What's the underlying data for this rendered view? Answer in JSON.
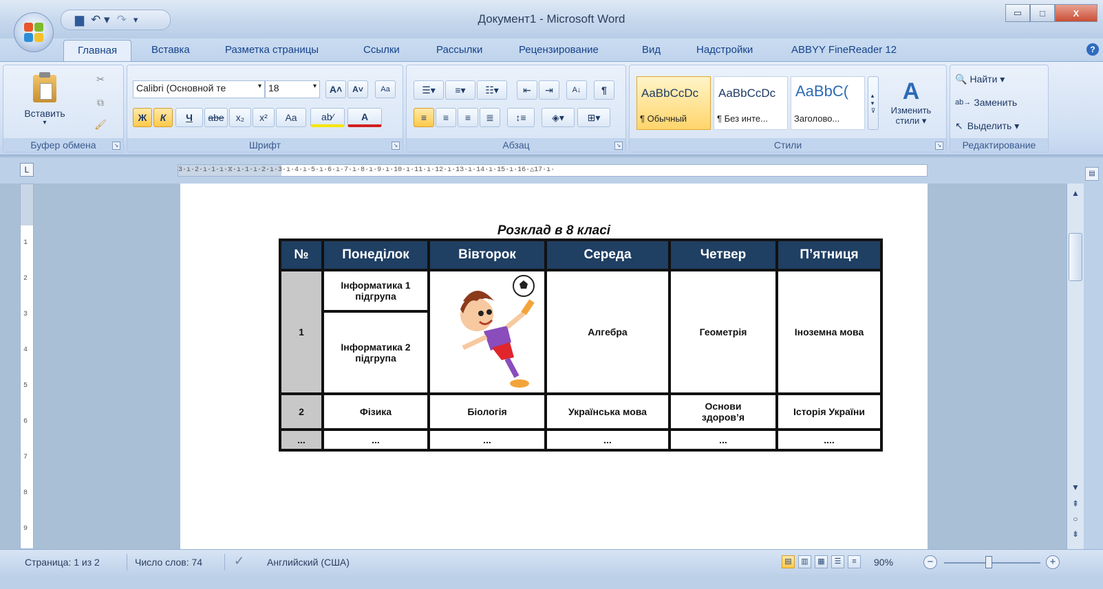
{
  "window": {
    "title": "Документ1 - Microsoft Word",
    "minimize": "–",
    "maximize": "□",
    "close": "X"
  },
  "qat": {
    "save": "💾",
    "undo": "↶ ▾",
    "redo": "↷",
    "more": "₹"
  },
  "tabs": [
    "Главная",
    "Вставка",
    "Разметка страницы",
    "Ссылки",
    "Рассылки",
    "Рецензирование",
    "Вид",
    "Надстройки",
    "ABBYY FineReader 12"
  ],
  "ribbon": {
    "clipboard": {
      "label": "Буфер обмена",
      "paste": "Вставить",
      "paste_arrow": "▾"
    },
    "font": {
      "label": "Шрифт",
      "font_name": "Calibri (Основной те",
      "font_size": "18",
      "grow": "A˄",
      "shrink": "A˅",
      "clear": "Aa",
      "bold": "Ж",
      "italic": "К",
      "underline": "Ч",
      "strike": "abe",
      "subscript": "x₂",
      "superscript": "x²",
      "case": "Aa",
      "highlight": "ab⁄",
      "color": "A"
    },
    "paragraph": {
      "label": "Абзац"
    },
    "styles": {
      "label": "Стили",
      "items": [
        {
          "sample": "AaBbCcDc",
          "name": "¶ Обычный"
        },
        {
          "sample": "AaBbCcDc",
          "name": "¶ Без инте..."
        },
        {
          "sample": "AaBbC(",
          "name": "Заголово..."
        }
      ],
      "change": "Изменить стили ▾"
    },
    "editing": {
      "label": "Редактирование",
      "find": "Найти ▾",
      "replace": "Заменить",
      "select": "Выделить ▾"
    }
  },
  "ruler": {
    "corner": "L",
    "marks": "3·ı·2·ı·1·ı·⧖·ı·1·ı·2·ı·3·ı·4·ı·5·ı·6·ı·7·ı·8·ı·9·ı·10·ı·11·ı·12·ı·13·ı·14·ı·15·ı·16·△17·ı·",
    "vmarks": [
      "1",
      "2",
      "3",
      "4",
      "5",
      "6",
      "7",
      "8",
      "9"
    ]
  },
  "document": {
    "title": "Розклад в 8 класі",
    "headers": [
      "№",
      "Понеділок",
      "Вівторок",
      "Середа",
      "Четвер",
      "П’ятниця"
    ],
    "row1": {
      "num": "1",
      "mon_a": "Інформатика 1 підгрупа",
      "mon_b": "Інформатика 2 підгрупа",
      "wed": "Алгебра",
      "thu": "Геометрія",
      "fri": "Іноземна мова"
    },
    "row2": [
      "2",
      "Фізика",
      "Біологія",
      "Українська  мова",
      "Основи здоров’я",
      "Історія України"
    ],
    "row3": [
      "...",
      "...",
      "...",
      "...",
      "...",
      "...."
    ]
  },
  "statusbar": {
    "page": "Страница: 1 из 2",
    "words": "Число слов: 74",
    "language": "Английский (США)",
    "zoom": "90%",
    "zoom_out": "−",
    "zoom_in": "+"
  }
}
